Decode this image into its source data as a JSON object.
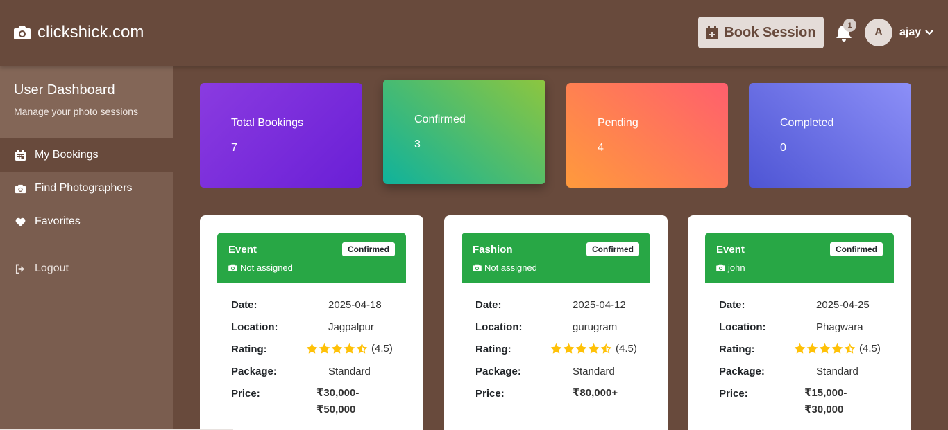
{
  "header": {
    "brand": "clickshick.com",
    "book_session": "Book Session",
    "notification_count": "1",
    "avatar_initial": "A",
    "username": "ajay"
  },
  "sidebar": {
    "title": "User Dashboard",
    "subtitle": "Manage your photo sessions",
    "items": [
      {
        "label": "My Bookings",
        "icon": "calendar-icon"
      },
      {
        "label": "Find Photographers",
        "icon": "camera-icon"
      },
      {
        "label": "Favorites",
        "icon": "heart-icon"
      },
      {
        "label": "Logout",
        "icon": "logout-icon"
      }
    ]
  },
  "stats": [
    {
      "label": "Total Bookings",
      "value": "7"
    },
    {
      "label": "Confirmed",
      "value": "3"
    },
    {
      "label": "Pending",
      "value": "4"
    },
    {
      "label": "Completed",
      "value": "0"
    }
  ],
  "field_labels": {
    "date": "Date:",
    "location": "Location:",
    "rating": "Rating:",
    "package": "Package:",
    "price": "Price:"
  },
  "bookings": [
    {
      "type": "Event",
      "status": "Confirmed",
      "photographer": "Not assigned",
      "date": "2025-04-18",
      "location": "Jagpalpur",
      "rating": "(4.5)",
      "package": "Standard",
      "price_line1": "₹30,000-",
      "price_line2": "₹50,000"
    },
    {
      "type": "Fashion",
      "status": "Confirmed",
      "photographer": "Not assigned",
      "date": "2025-04-12",
      "location": "gurugram",
      "rating": "(4.5)",
      "package": "Standard",
      "price_line1": "₹80,000+",
      "price_line2": ""
    },
    {
      "type": "Event",
      "status": "Confirmed",
      "photographer": "john",
      "date": "2025-04-25",
      "location": "Phagwara",
      "rating": "(4.5)",
      "package": "Standard",
      "price_line1": "₹15,000-",
      "price_line2": "₹30,000"
    }
  ],
  "colors": {
    "background": "#684a3c",
    "sidebar": "#7a5d4f",
    "card_header": "#28a745",
    "star": "#ffc107"
  }
}
